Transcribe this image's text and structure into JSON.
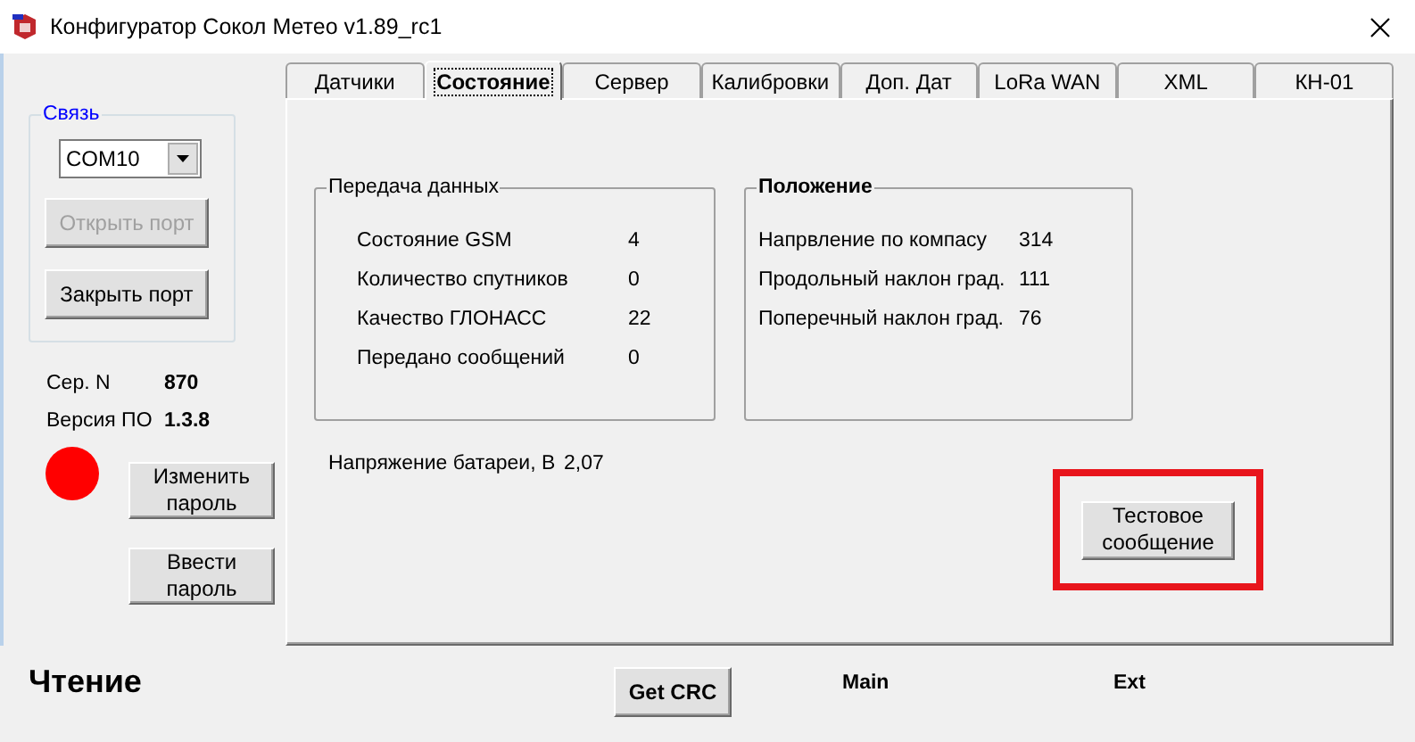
{
  "window": {
    "title": "Конфигуратор Сокол Метео v1.89_rc1"
  },
  "connection": {
    "legend": "Связь",
    "port": "COM10",
    "buttons": [
      {
        "label": "Открыть порт",
        "disabled": true
      },
      {
        "label": "Закрыть порт",
        "disabled": false
      }
    ]
  },
  "device": [
    {
      "label": "Сер. N",
      "value": "870"
    },
    {
      "label": "Версия ПО",
      "value": "1.3.8"
    }
  ],
  "password_buttons": [
    "Изменить пароль",
    "Ввести пароль"
  ],
  "tabs": [
    {
      "label": "Датчики",
      "selected": false
    },
    {
      "label": "Состояние",
      "selected": true
    },
    {
      "label": "Сервер",
      "selected": false
    },
    {
      "label": "Калибровки",
      "selected": false
    },
    {
      "label": "Доп. Дат",
      "selected": false
    },
    {
      "label": "LoRa WAN",
      "selected": false
    },
    {
      "label": "XML",
      "selected": false
    },
    {
      "label": "КН-01",
      "selected": false
    }
  ],
  "transmission": {
    "title": "Передача данных",
    "rows": [
      {
        "label": "Состояние GSM",
        "value": "4"
      },
      {
        "label": "Количество спутников",
        "value": "0"
      },
      {
        "label": "Качество ГЛОНАСС",
        "value": "22"
      },
      {
        "label": "Передано сообщений",
        "value": "0"
      }
    ]
  },
  "position": {
    "title": "Положение",
    "rows": [
      {
        "label": "Напрвление по компасу",
        "value": "314"
      },
      {
        "label": "Продольный наклон град.",
        "value": "111"
      },
      {
        "label": "Поперечный наклон град.",
        "value": "76"
      }
    ]
  },
  "battery": {
    "label": "Напряжение батареи, В",
    "value": "2,07"
  },
  "test_button": {
    "label": "Тестовое сообщение",
    "highlighted": true
  },
  "status": "Чтение",
  "crc_button": "Get CRC",
  "footer_labels": [
    "Main",
    "Ext"
  ]
}
